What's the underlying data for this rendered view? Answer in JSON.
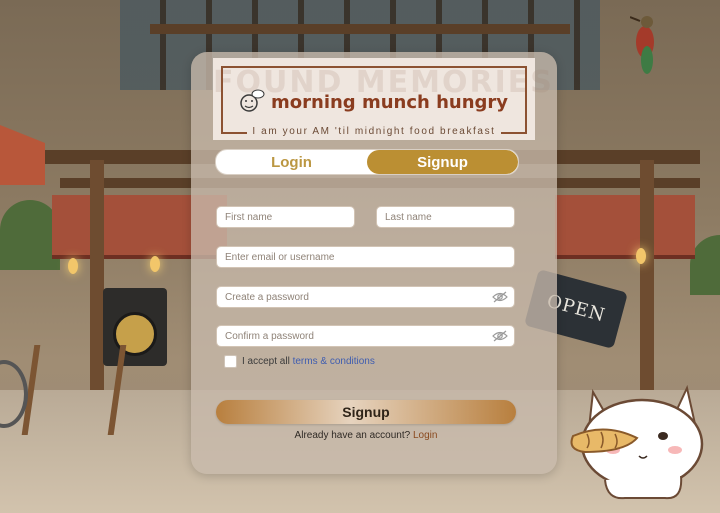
{
  "background": {
    "open_sign": "OPEN"
  },
  "banner": {
    "watermark": "FOUND MEMORIES",
    "title": "morning munch hungry",
    "tagline": "I am your AM 'til midnight food breakfast"
  },
  "tabs": {
    "login": "Login",
    "signup": "Signup",
    "active": "signup"
  },
  "form": {
    "first_name": {
      "value": "",
      "placeholder": "First name"
    },
    "last_name": {
      "value": "",
      "placeholder": "Last name"
    },
    "email": {
      "value": "",
      "placeholder": "Enter email or username"
    },
    "password": {
      "value": "",
      "placeholder": "Create a password"
    },
    "confirm_password": {
      "value": "",
      "placeholder": "Confirm a password"
    },
    "terms_prefix": "I accept all",
    "terms_link": "terms & conditions",
    "submit_label": "Signup",
    "account_prompt": "Already have an account?",
    "login_link": "Login"
  },
  "colors": {
    "accent": "#bb8f33",
    "title": "#8a3c1f",
    "link": "#3f5db0"
  },
  "icons": {
    "password_toggle": "eye-slash-icon",
    "logo": "face-logo-icon"
  }
}
